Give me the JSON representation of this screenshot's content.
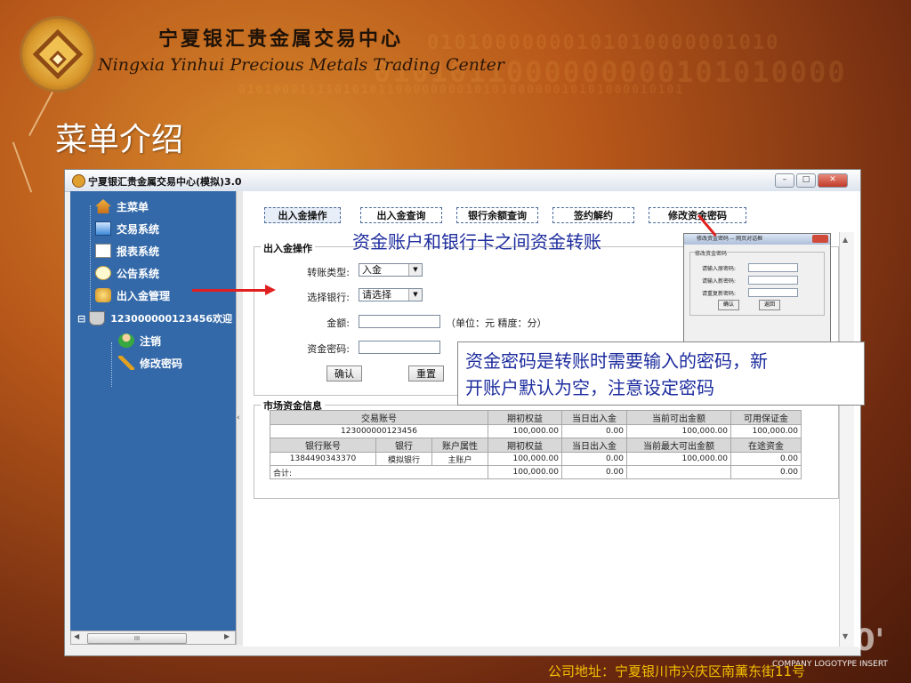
{
  "header": {
    "company_cn": "宁夏银汇贵金属交易中心",
    "company_en": "Ningxia Yinhui Precious Metals Trading Center",
    "background_binary": [
      "01010000000101010000001010",
      "0101011000000000101010000",
      "010100011110101011000000001010100000010101000010101"
    ]
  },
  "slide": {
    "title": "菜单介绍"
  },
  "window": {
    "title": "宁夏银汇贵金属交易中心(模拟)3.0",
    "controls": {
      "minimize": "–",
      "maximize": "□",
      "close": "✕"
    }
  },
  "sidebar": {
    "items": [
      {
        "label": "主菜单",
        "icon": "home-icon"
      },
      {
        "label": "交易系统",
        "icon": "monitor-icon"
      },
      {
        "label": "报表系统",
        "icon": "chart-icon"
      },
      {
        "label": "公告系统",
        "icon": "chat-bubble-icon"
      },
      {
        "label": "出入金管理",
        "icon": "coins-icon"
      },
      {
        "label": "123000000123456欢迎",
        "icon": "coffee-cup-icon",
        "expander": "⊟"
      },
      {
        "label": "注销",
        "icon": "user-icon"
      },
      {
        "label": "修改密码",
        "icon": "key-icon"
      }
    ],
    "scrollbar_thumb": "III",
    "scroll_left": "◀",
    "scroll_right": "▶"
  },
  "splitter_arrow": "‹",
  "tabs": [
    "出入金操作",
    "出入金查询",
    "银行余额查询",
    "签约解约",
    "修改资金密码"
  ],
  "form": {
    "legend": "出入金操作",
    "transfer_type_label": "转账类型:",
    "transfer_type_value": "入金",
    "bank_label": "选择银行:",
    "bank_value": "请选择",
    "amount_label": "金额:",
    "amount_value": "",
    "amount_unit": "（单位：元 精度：分）",
    "password_label": "资金密码:",
    "password_value": "",
    "confirm_btn": "确认",
    "reset_btn": "重置"
  },
  "market": {
    "legend": "市场资金信息",
    "top_headers": [
      "交易账号",
      "期初权益",
      "当日出入金",
      "当前可出金额",
      "可用保证金"
    ],
    "top_row": [
      "123000000123456",
      "100,000.00",
      "0.00",
      "100,000.00",
      "100,000.00"
    ],
    "bottom_headers": [
      "银行账号",
      "银行",
      "账户属性",
      "期初权益",
      "当日出入金",
      "当前最大可出金额",
      "在途资金"
    ],
    "bottom_row": [
      "1384490343370",
      "模拟银行",
      "主账户",
      "100,000.00",
      "0.00",
      "100,000.00",
      "0.00"
    ],
    "total_row": [
      "合计:",
      "100,000.00",
      "0.00",
      "0.00"
    ]
  },
  "annotations": {
    "top": "资金账户和银行卡之间资金转账",
    "box_line1": "资金密码是转账时需要输入的密码，新",
    "box_line2": "开账户默认为空，注意设定密码"
  },
  "popup": {
    "title": "修改资金密码 -- 网页对话框",
    "group": "修改资金密码",
    "old_label": "请输入原密码:",
    "new_label": "请输入新密码:",
    "repeat_label": "请重复新密码:",
    "ok": "确认",
    "back": "返回"
  },
  "footer": {
    "address": "公司地址：宁夏银川市兴庆区南薰东街11号",
    "logotype": "COMPANY LOGOTYPE INSERT",
    "big_mark": "0'"
  },
  "colors": {
    "annotation_text": "#1d2c9e",
    "arrow": "#e02020",
    "sidebar_bg": "#3369a9",
    "footer_text": "#f5c000"
  }
}
